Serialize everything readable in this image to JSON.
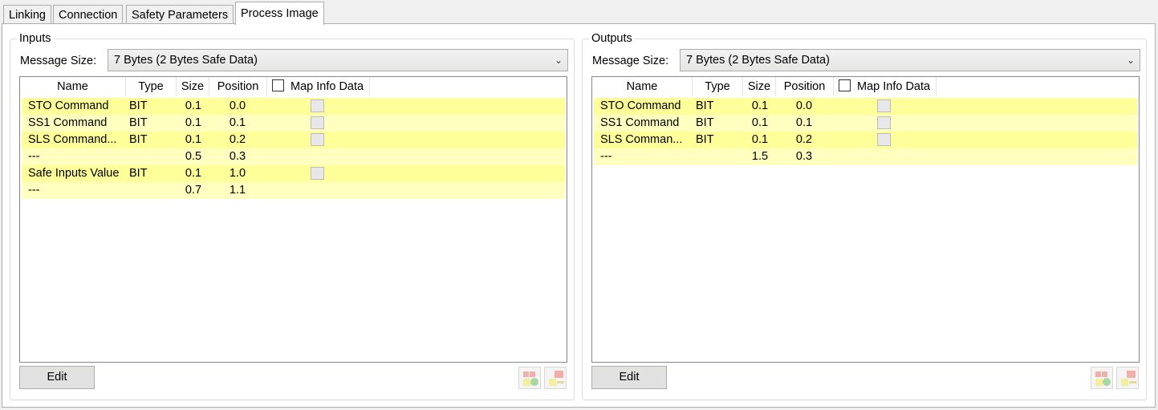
{
  "tabs": [
    {
      "label": "Linking"
    },
    {
      "label": "Connection"
    },
    {
      "label": "Safety Parameters"
    },
    {
      "label": "Process Image"
    }
  ],
  "columns": {
    "name": "Name",
    "type": "Type",
    "size": "Size",
    "position": "Position",
    "map_info": "Map Info Data"
  },
  "inputs": {
    "title": "Inputs",
    "message_size_label": "Message Size:",
    "message_size_value": "7 Bytes (2 Bytes Safe Data)",
    "rows": [
      {
        "name": "STO Command",
        "type": "BIT",
        "size": "0.1",
        "position": "0.0",
        "checkbox": true
      },
      {
        "name": "SS1 Command",
        "type": "BIT",
        "size": "0.1",
        "position": "0.1",
        "checkbox": true
      },
      {
        "name": "SLS Command...",
        "type": "BIT",
        "size": "0.1",
        "position": "0.2",
        "checkbox": true
      },
      {
        "name": "---",
        "type": "",
        "size": "0.5",
        "position": "0.3",
        "checkbox": false
      },
      {
        "name": "Safe Inputs Value",
        "type": "BIT",
        "size": "0.1",
        "position": "1.0",
        "checkbox": true
      },
      {
        "name": "---",
        "type": "",
        "size": "0.7",
        "position": "1.1",
        "checkbox": false
      }
    ],
    "edit_label": "Edit"
  },
  "outputs": {
    "title": "Outputs",
    "message_size_label": "Message Size:",
    "message_size_value": "7 Bytes (2 Bytes Safe Data)",
    "rows": [
      {
        "name": "STO Command",
        "type": "BIT",
        "size": "0.1",
        "position": "0.0",
        "checkbox": true
      },
      {
        "name": "SS1 Command",
        "type": "BIT",
        "size": "0.1",
        "position": "0.1",
        "checkbox": true
      },
      {
        "name": "SLS Comman...",
        "type": "BIT",
        "size": "0.1",
        "position": "0.2",
        "checkbox": true
      },
      {
        "name": "---",
        "type": "",
        "size": "1.5",
        "position": "0.3",
        "checkbox": false
      }
    ],
    "edit_label": "Edit"
  },
  "icons": {
    "add": "add-mapping-icon",
    "remove": "remove-mapping-icon",
    "chevron": "chevron-down-icon"
  },
  "colors": {
    "row_dark": "#ffff99",
    "row_light": "#ffffc0"
  }
}
